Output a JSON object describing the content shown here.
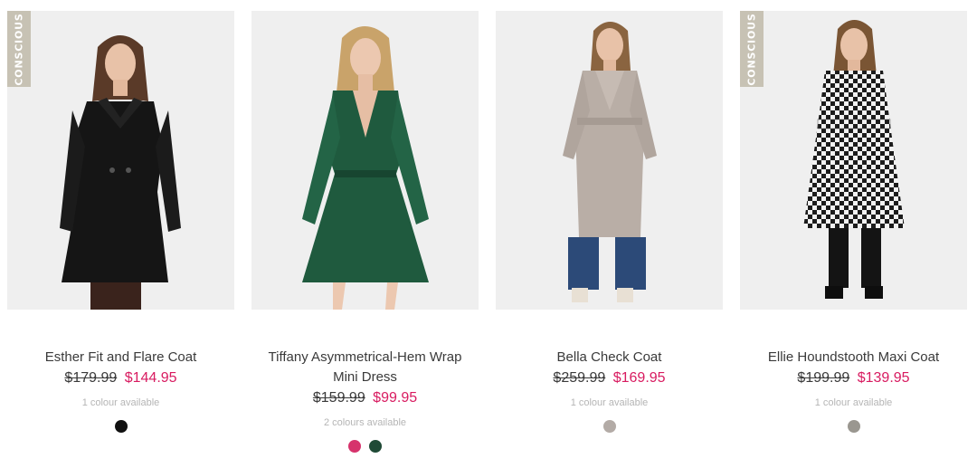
{
  "products": [
    {
      "name": "Esther Fit and Flare Coat",
      "badge": "CONSCIOUS",
      "was_price": "$179.99",
      "now_price": "$144.95",
      "colours_text": "1 colour available",
      "swatches": [
        "#111111"
      ],
      "image_alt": "Woman wearing a black fit and flare coat"
    },
    {
      "name": "Tiffany Asymmetrical-Hem Wrap Mini Dress",
      "badge": "",
      "was_price": "$159.99",
      "now_price": "$99.95",
      "colours_text": "2 colours available",
      "swatches": [
        "#d6336c",
        "#1f4a36"
      ],
      "image_alt": "Woman wearing a green satin wrap mini dress"
    },
    {
      "name": "Bella Check Coat",
      "badge": "",
      "was_price": "$259.99",
      "now_price": "$169.95",
      "colours_text": "1 colour available",
      "swatches": [
        "#b3aba6"
      ],
      "image_alt": "Woman wearing a long grey check coat with jeans"
    },
    {
      "name": "Ellie Houndstooth Maxi Coat",
      "badge": "CONSCIOUS",
      "was_price": "$199.99",
      "now_price": "$139.95",
      "colours_text": "1 colour available",
      "swatches": [
        "#9a9790"
      ],
      "image_alt": "Woman wearing a houndstooth maxi coat"
    }
  ],
  "colors": {
    "sale_price": "#d81b60",
    "badge_bg": "#c7c2b4",
    "image_bg": "#efefef"
  }
}
